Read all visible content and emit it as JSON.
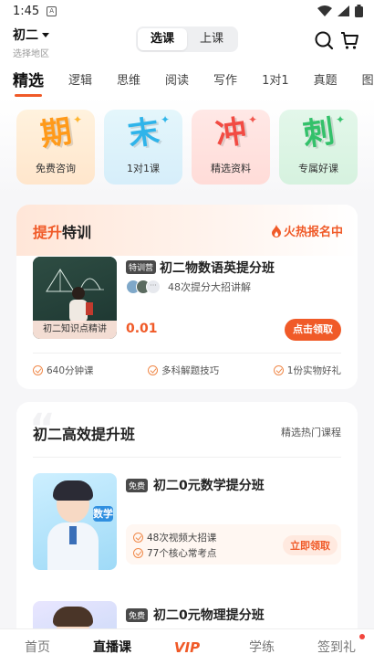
{
  "status_bar": {
    "time": "1:45",
    "notification_icon": "A"
  },
  "header": {
    "grade": "初二",
    "region_hint": "选择地区",
    "segments": [
      "选课",
      "上课"
    ],
    "active_segment": 0
  },
  "tabs": [
    "精选",
    "逻辑",
    "思维",
    "阅读",
    "写作",
    "1对1",
    "真题",
    "图"
  ],
  "active_tab": 0,
  "features": [
    {
      "glyph": "期",
      "label": "免费咨询"
    },
    {
      "glyph": "末",
      "label": "1对1课"
    },
    {
      "glyph": "冲",
      "label": "精选资料"
    },
    {
      "glyph": "刺",
      "label": "专属好课"
    }
  ],
  "special": {
    "title_highlight": "提升",
    "title_rest": "特训",
    "hot_label": "火热报名中",
    "thumb_caption": "初二知识点精讲",
    "badge": "特训营",
    "course_name": "初二物数语英提分班",
    "subtitle": "48次提分大招讲解",
    "price": "0.01",
    "claim_button": "点击领取",
    "perks": [
      "640分钟课",
      "多科解题技巧",
      "1份实物好礼"
    ]
  },
  "classes": {
    "title": "初二高效提升班",
    "more_link": "精选热门课程",
    "courses": [
      {
        "tag": "免费",
        "name": "初二0元数学提分班",
        "subject": "数学",
        "points": [
          "48次视频大招课",
          "77个核心常考点"
        ],
        "button": "立即领取"
      },
      {
        "tag": "免费",
        "name": "初二0元物理提分班"
      }
    ]
  },
  "bottom_nav": [
    "首页",
    "直播课",
    "VIP",
    "学练",
    "签到礼"
  ],
  "active_nav": 1,
  "colors": {
    "accent": "#f05a28",
    "page_bg": "#f6f6f8"
  }
}
